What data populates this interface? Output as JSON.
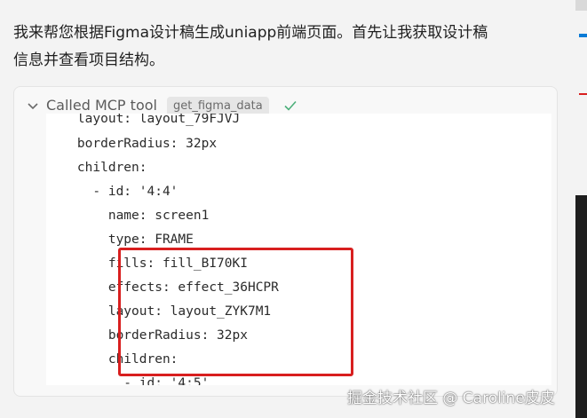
{
  "message": {
    "line1": "我来帮您根据Figma设计稿生成uniapp前端页面。首先让我获取设计稿",
    "line2": "信息并查看项目结构。"
  },
  "tool_call": {
    "title": "Called MCP tool",
    "tool_name": "get_figma_data",
    "status_icon": "check-icon",
    "expand_icon": "chevron-down-icon"
  },
  "code_lines": [
    "    layout: layout_79FJVJ",
    "    borderRadius: 32px",
    "    children:",
    "      - id: '4:4'",
    "        name: screen1",
    "        type: FRAME",
    "        fills: fill_BI70KI",
    "        effects: effect_36HCPR",
    "        layout: layout_ZYK7M1",
    "        borderRadius: 32px",
    "        children:",
    "          - id: '4:5'"
  ],
  "watermark": "掘金技术社区 @ Caroline皮皮",
  "colors": {
    "highlight": "#d81f1f",
    "accent": "#0a7bd6",
    "check": "#4caf7a"
  }
}
